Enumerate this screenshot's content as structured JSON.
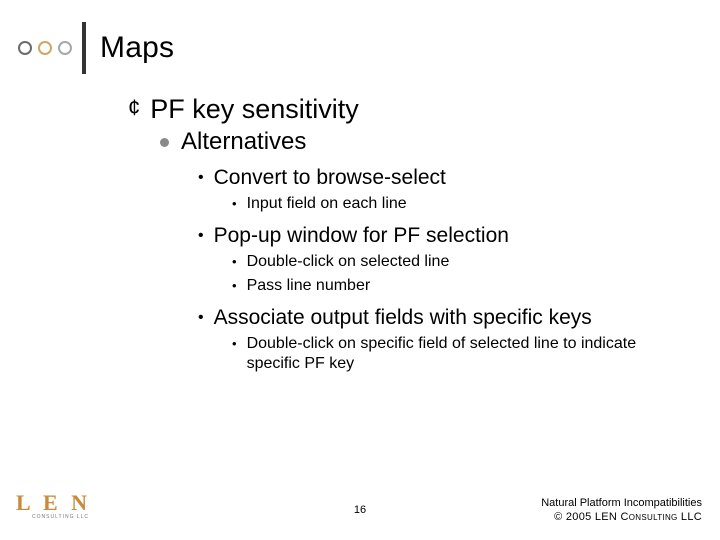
{
  "title": "Maps",
  "bullets": {
    "l1_1": "PF key sensitivity",
    "l2_1": "Alternatives",
    "l3_1": "Convert to browse-select",
    "l4_1": "Input field on each line",
    "l3_2": "Pop-up window for PF selection",
    "l4_2": "Double-click on selected line",
    "l4_3": "Pass line number",
    "l3_3": "Associate output fields with specific keys",
    "l4_4": "Double-click on specific field of selected line to indicate specific PF key"
  },
  "logo": {
    "brand": "L E N",
    "sub": "CONSULTING LLC"
  },
  "page_number": "16",
  "footer": {
    "line1": "Natural Platform Incompatibilities",
    "line2": "© 2005 LEN Consulting LLC"
  }
}
